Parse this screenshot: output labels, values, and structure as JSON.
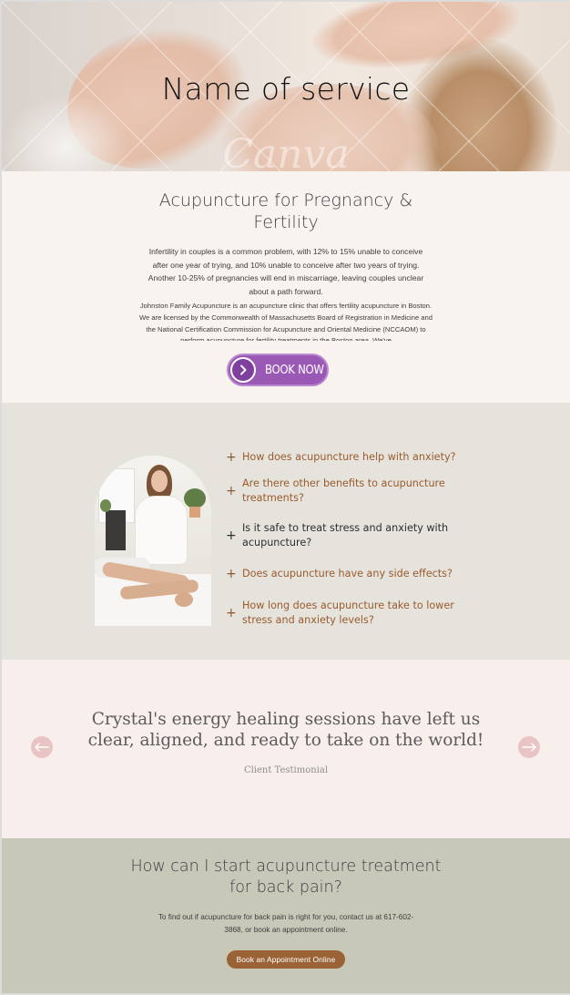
{
  "hero": {
    "title": "Name of service",
    "watermark": "Canva"
  },
  "intro": {
    "title": "Acupuncture for Pregnancy & Fertility",
    "paragraph1": "Infertility in couples is a common problem, with 12% to 15% unable to conceive after one year of trying, and 10% unable to conceive after two years of trying. Another 10-25% of pregnancies will end in miscarriage, leaving couples unclear about a path forward.",
    "paragraph2": "Johnston Family Acupuncture is an acupuncture clinic that offers fertility acupuncture in Boston. We are licensed by the Commonwealth of Massachusetts Board of Registration in Medicine and the National Certification Commission for Acupuncture and Oriental Medicine (NCCAOM) to perform acupuncture for fertility treatments in the Boston area. We've",
    "book_button": "BOOK NOW",
    "book_button_color": "#9b59b6"
  },
  "faq": {
    "items": [
      {
        "question": "How does acupuncture help with anxiety?"
      },
      {
        "question": "Are there other benefits to acupuncture treatments?"
      },
      {
        "question": "Is it safe to treat stress and anxiety with acupuncture?"
      },
      {
        "question": "Does acupuncture have any side effects?"
      },
      {
        "question": "How long does acupuncture take to lower stress and anxiety levels?"
      }
    ],
    "accent_color": "#9a5b2f"
  },
  "testimonial": {
    "quote": "Crystal's energy healing sessions have left us clear, aligned, and ready to take on the world!",
    "attribution": "Client Testimonial",
    "prev_icon": "arrow-left-icon",
    "next_icon": "arrow-right-icon"
  },
  "contact": {
    "title": "How can I start acupuncture treatment for back pain?",
    "text": "To find out if acupuncture for back pain is right for you, contact us at 617-602-3868, or book an appointment online.",
    "button": "Book an Appointment Online",
    "button_color": "#9a6336"
  }
}
